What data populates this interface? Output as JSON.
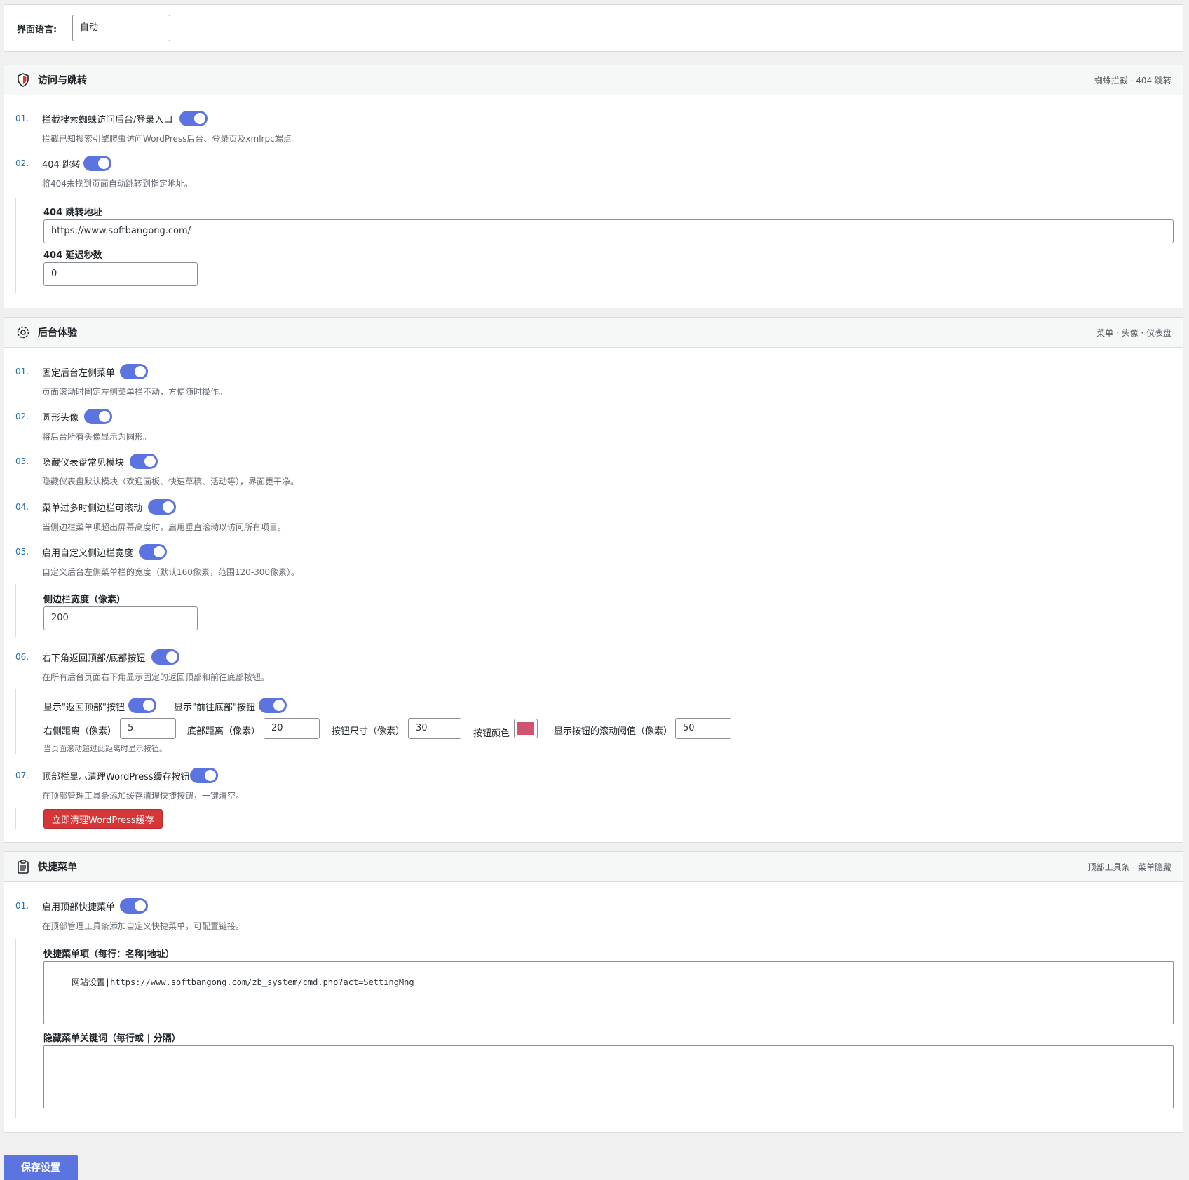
{
  "language": {
    "label": "界面语言:",
    "value": "自动"
  },
  "sections": {
    "access": {
      "title": "访问与跳转",
      "subtitle": "蜘蛛拦截 · 404 跳转",
      "items": [
        {
          "num": "01.",
          "label": "拦截搜索蜘蛛访问后台/登录入口",
          "desc": "拦截已知搜索引擎爬虫访问WordPress后台、登录页及xmlrpc端点。"
        },
        {
          "num": "02.",
          "label": "404 跳转",
          "desc": "将404未找到页面自动跳转到指定地址。"
        }
      ],
      "redirect_url_label": "404 跳转地址",
      "redirect_url_value": "https://www.softbangong.com/",
      "delay_label": "404 延迟秒数",
      "delay_value": "0"
    },
    "backend": {
      "title": "后台体验",
      "subtitle": "菜单 · 头像 · 仪表盘",
      "items": [
        {
          "num": "01.",
          "label": "固定后台左侧菜单",
          "desc": "页面滚动时固定左侧菜单栏不动，方便随时操作。"
        },
        {
          "num": "02.",
          "label": "圆形头像",
          "desc": "将后台所有头像显示为圆形。"
        },
        {
          "num": "03.",
          "label": "隐藏仪表盘常见模块",
          "desc": "隐藏仪表盘默认模块（欢迎面板、快速草稿、活动等），界面更干净。"
        },
        {
          "num": "04.",
          "label": "菜单过多时侧边栏可滚动",
          "desc": "当侧边栏菜单项超出屏幕高度时，启用垂直滚动以访问所有项目。"
        },
        {
          "num": "05.",
          "label": "启用自定义侧边栏宽度",
          "desc": "自定义后台左侧菜单栏的宽度（默认160像素，范围120-300像素）。"
        },
        {
          "num": "06.",
          "label": "右下角返回顶部/底部按钮",
          "desc": "在所有后台页面右下角显示固定的返回顶部和前往底部按钮。"
        },
        {
          "num": "07.",
          "label": "顶部栏显示清理WordPress缓存按钮",
          "desc": "在顶部管理工具条添加缓存清理快捷按钮，一键清空。"
        }
      ],
      "sidebar_width_label": "侧边栏宽度（像素）",
      "sidebar_width_value": "200",
      "show_top_label": "显示\"返回顶部\"按钮",
      "show_bottom_label": "显示\"前往底部\"按钮",
      "right_label": "右侧距离（像素）",
      "right_value": "5",
      "bottom_label": "底部距离（像素）",
      "bottom_value": "20",
      "size_label": "按钮尺寸（像素）",
      "size_value": "30",
      "color_label": "按钮颜色",
      "button_color": "#d0536f",
      "threshold_label": "显示按钮的滚动阈值（像素）",
      "threshold_value": "50",
      "threshold_hint": "当页面滚动超过此距离时显示按钮。",
      "clear_cache_button": "立即清理WordPress缓存"
    },
    "quickmenu": {
      "title": "快捷菜单",
      "subtitle": "顶部工具条 · 菜单隐藏",
      "items": [
        {
          "num": "01.",
          "label": "启用顶部快捷菜单",
          "desc": "在顶部管理工具条添加自定义快捷菜单，可配置链接。"
        }
      ],
      "items_label": "快捷菜单项（每行：名称|地址）",
      "items_value": "网站设置|https://www.softbangong.com/zb_system/cmd.php?act=SettingMng",
      "hide_label": "隐藏菜单关键词（每行或 | 分隔）",
      "hide_value": ""
    }
  },
  "save_button": "保存设置",
  "colors": {
    "accent": "#5b74e0",
    "danger": "#d63638",
    "link": "#2271b1"
  }
}
